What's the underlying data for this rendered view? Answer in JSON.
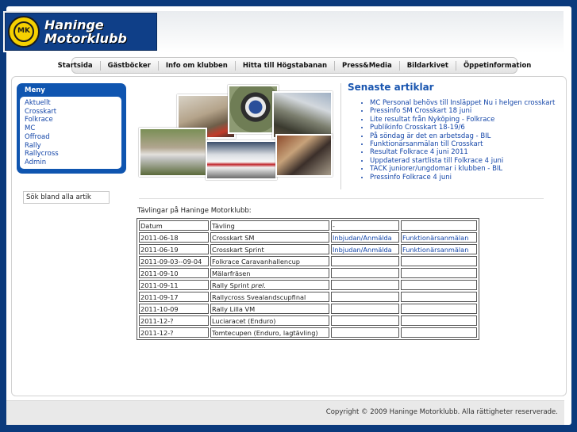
{
  "brand": {
    "badge_letters": "MK",
    "line1": "Haninge",
    "line2": "Motorklubb"
  },
  "nav": [
    "Startsida",
    "Gästböcker",
    "Info om klubben",
    "Hitta till Högstabanan",
    "Press&Media",
    "Bildarkivet",
    "Öppetinformation"
  ],
  "menu": {
    "title": "Meny",
    "items": [
      "Aktuellt",
      "Crosskart",
      "Folkrace",
      "MC",
      "Offroad",
      "Rally",
      "Rallycross",
      "Admin"
    ]
  },
  "search": {
    "value": "Sök bland alla artik"
  },
  "articles": {
    "title": "Senaste artiklar",
    "items": [
      "MC Personal behövs till Insläppet Nu i helgen crosskart",
      "Pressinfo SM Crosskart 18 juni",
      "Lite resultat från Nyköping - Folkrace",
      "Publikinfo Crosskart 18-19/6",
      "På söndag är det en arbetsdag - BIL",
      "Funktionärsanmälan till Crosskart",
      "Resultat Folkrace 4 juni 2011",
      "Uppdaterad startlista till Folkrace 4 juni",
      "TACK juniorer/ungdomar i klubben - BIL",
      "Pressinfo Folkrace 4 juni"
    ]
  },
  "competitions": {
    "heading": "Tävlingar på Haninge Motorklubb:",
    "header": [
      "Datum",
      "Tävling",
      "-",
      ""
    ],
    "rows": [
      {
        "date": "2011-06-18",
        "name": "Crosskart SM",
        "name_suffix": "",
        "link1": "Inbjudan/Anmälda",
        "link2": "Funktionärsanmälan"
      },
      {
        "date": "2011-06-19",
        "name": "Crosskart Sprint",
        "name_suffix": "",
        "link1": "Inbjudan/Anmälda",
        "link2": "Funktionärsanmälan"
      },
      {
        "date": "2011-09-03--09-04",
        "name": "Folkrace Caravanhallencup",
        "name_suffix": "",
        "link1": "",
        "link2": ""
      },
      {
        "date": "2011-09-10",
        "name": "Mälarfräsen",
        "name_suffix": "",
        "link1": "",
        "link2": ""
      },
      {
        "date": "2011-09-11",
        "name": "Rally Sprint ",
        "name_suffix": "prel.",
        "link1": "",
        "link2": ""
      },
      {
        "date": "2011-09-17",
        "name": "Rallycross Svealandscupfinal",
        "name_suffix": "",
        "link1": "",
        "link2": ""
      },
      {
        "date": "2011-10-09",
        "name": "Rally Lilla VM",
        "name_suffix": "",
        "link1": "",
        "link2": ""
      },
      {
        "date": "2011-12-?",
        "name": "Luciaracet (Enduro)",
        "name_suffix": "",
        "link1": "",
        "link2": ""
      },
      {
        "date": "2011-12-?",
        "name": "Tomtecupen (Enduro, lagtävling)",
        "name_suffix": "",
        "link1": "",
        "link2": ""
      }
    ]
  },
  "footer": {
    "copyright": "Copyright © 2009 Haninge Motorklubb. Alla rättigheter reserverade."
  },
  "colors": {
    "background": "#0b3a7c",
    "menu": "#0f55b0",
    "link": "#1345a8",
    "logo_yellow": "#f5d000"
  }
}
